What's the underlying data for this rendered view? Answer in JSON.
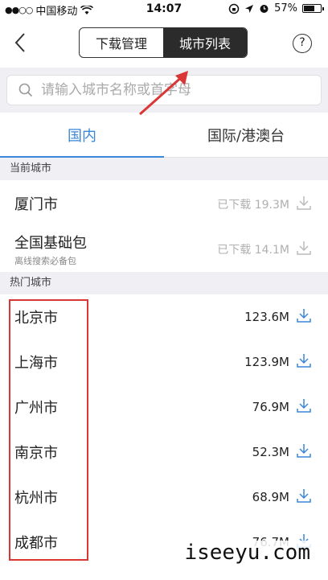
{
  "status_bar": {
    "signal": "●●○○",
    "carrier": "中国移动",
    "time": "14:07",
    "battery": "57%",
    "battery_level": 0.57
  },
  "nav": {
    "seg_left": "下载管理",
    "seg_right": "城市列表",
    "help": "?"
  },
  "search": {
    "placeholder": "请输入城市名称或首字母"
  },
  "tabs": [
    "国内",
    "国际/港澳台"
  ],
  "current_section": "当前城市",
  "current_items": [
    {
      "name": "厦门市",
      "status": "已下载 19.3M"
    },
    {
      "name": "全国基础包",
      "sub": "离线搜索必备包",
      "status": "已下载 14.1M"
    }
  ],
  "hot_section": "热门城市",
  "hot_items": [
    {
      "name": "北京市",
      "size": "123.6M"
    },
    {
      "name": "上海市",
      "size": "123.9M"
    },
    {
      "name": "广州市",
      "size": "76.9M"
    },
    {
      "name": "南京市",
      "size": "52.3M"
    },
    {
      "name": "杭州市",
      "size": "68.9M"
    },
    {
      "name": "成都市",
      "size": "76.7M"
    }
  ],
  "watermark": "iseeyu.com",
  "colors": {
    "accent": "#3a86d8",
    "annotation": "#d93636"
  }
}
